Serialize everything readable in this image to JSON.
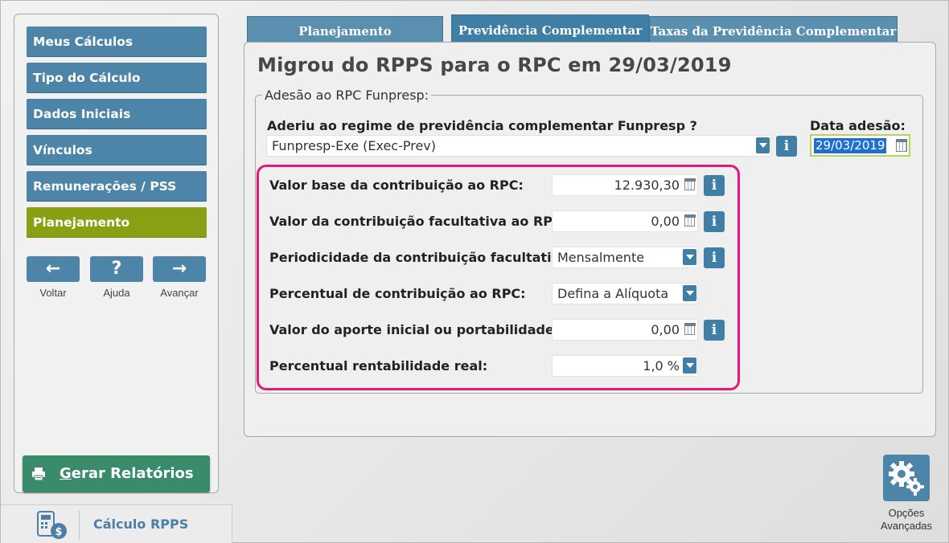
{
  "sidebar": {
    "items": [
      {
        "label": "Meus Cálculos"
      },
      {
        "label": "Tipo do Cálculo"
      },
      {
        "label": "Dados Iniciais"
      },
      {
        "label": "Vínculos"
      },
      {
        "label": "Remunerações / PSS"
      },
      {
        "label": "Planejamento",
        "active": true
      }
    ],
    "nav": {
      "back": {
        "symbol": "←",
        "label": "Voltar"
      },
      "help": {
        "symbol": "?",
        "label": "Ajuda"
      },
      "forward": {
        "symbol": "→",
        "label": "Avançar"
      }
    },
    "report_button": {
      "label_underlined": "G",
      "label_rest": "erar Relatórios",
      "icon": "printer-icon"
    },
    "footer": {
      "title": "Cálculo RPPS",
      "icon": "calculator-money-icon"
    }
  },
  "tabs": [
    {
      "label": "Planejamento Previdenciário"
    },
    {
      "label": "Previdência Complementar",
      "active": true
    },
    {
      "label": "Taxas da Previdência Complementar"
    }
  ],
  "main": {
    "title": "Migrou do RPPS para o RPC em 29/03/2019",
    "fieldset_legend": "Adesão ao RPC Funpresp:",
    "adhesion_question": "Aderiu ao regime de previdência complementar Funpresp ?",
    "adhesion_value": "Funpresp-Exe (Exec-Prev)",
    "date_label": "Data adesão:",
    "date_value": "29/03/2019",
    "rows": [
      {
        "label": "Valor base da contribuição ao RPC:",
        "value": "12.930,30"
      },
      {
        "label": "Valor da contribuição facultativa ao RPC:",
        "value": "0,00"
      },
      {
        "label": "Periodicidade da contribuição facultativa:",
        "value": "Mensalmente"
      },
      {
        "label": "Percentual de contribuição ao RPC:",
        "value": "Defina a Alíquota"
      },
      {
        "label": "Valor do aporte inicial ou portabilidade:",
        "value": "0,00"
      },
      {
        "label": "Percentual rentabilidade real:",
        "value": "1,0 %"
      }
    ],
    "info_symbol": "i"
  },
  "options": {
    "label_line1": "Opções",
    "label_line2": "Avançadas",
    "icon": "gears-icon"
  },
  "colors": {
    "nav_blue": "#4d85a8",
    "active_green": "#88a114",
    "report_green": "#3a8a6c",
    "highlight_pink": "#e6177a"
  }
}
